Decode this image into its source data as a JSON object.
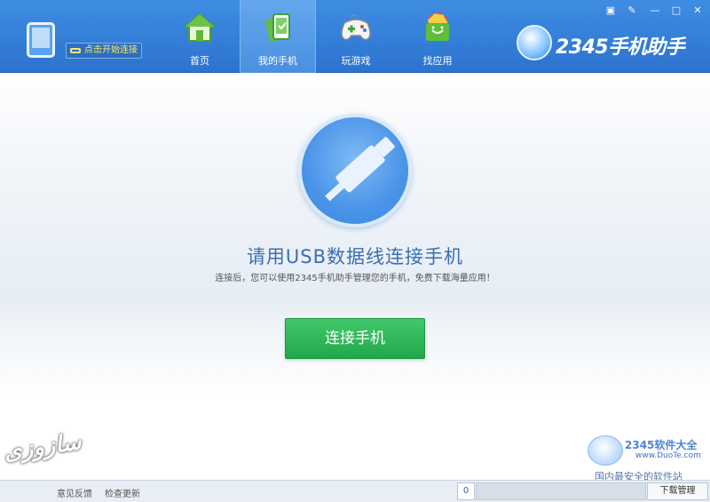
{
  "header": {
    "connect_hint": "点击开始连接",
    "nav": [
      {
        "label": "首页",
        "icon": "house-icon"
      },
      {
        "label": "我的手机",
        "icon": "phone-shield-icon",
        "active": true
      },
      {
        "label": "玩游戏",
        "icon": "gamepad-icon"
      },
      {
        "label": "找应用",
        "icon": "app-bag-icon"
      }
    ],
    "logo_text": "2345手机助手",
    "window_controls": [
      {
        "name": "feedback-icon",
        "glyph": "▣"
      },
      {
        "name": "settings-wrench-icon",
        "glyph": "✎"
      },
      {
        "name": "minimize-icon",
        "glyph": "—"
      },
      {
        "name": "maximize-icon",
        "glyph": "□"
      },
      {
        "name": "close-icon",
        "glyph": "✕"
      }
    ]
  },
  "main": {
    "headline": "请用USB数据线连接手机",
    "subline": "连接后，您可以使用2345手机助手管理您的手机，免费下载海量应用！",
    "connect_button": "连接手机"
  },
  "watermark": {
    "brand": "2345软件大全",
    "url": "www.DuoTe.com",
    "slogan": "国内最安全的软件站",
    "left_mark": "سازوزی"
  },
  "statusbar": {
    "links": [
      "意见反馈",
      "检查更新"
    ],
    "download_count": "0",
    "download_manage": "下载管理"
  },
  "colors": {
    "header_blue": "#2c73cf",
    "button_green": "#22a84a",
    "headline_blue": "#3a6fb0"
  }
}
